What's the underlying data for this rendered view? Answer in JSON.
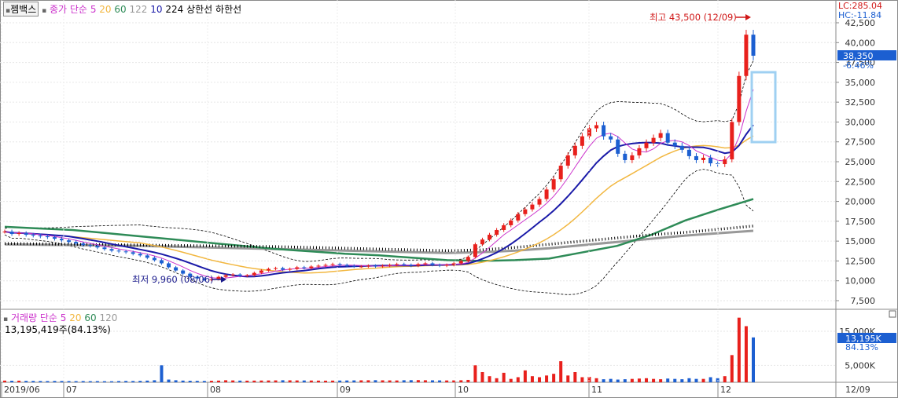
{
  "header": {
    "stock_name": "젬백스",
    "price_ma_label": "종가 단순",
    "ma_periods": [
      "5",
      "20",
      "60",
      "122",
      "10",
      "224"
    ],
    "upper_limit": "상한선",
    "lower_limit": "하한선"
  },
  "volume_header": {
    "label": "거래량 단순",
    "ma_periods": [
      "5",
      "20",
      "60",
      "120"
    ],
    "current_text": "13,195,419주(84.13%)"
  },
  "price_axis": {
    "ticks": [
      "42,500",
      "40,000",
      "37,500",
      "35,000",
      "32,500",
      "30,000",
      "27,500",
      "25,000",
      "22,500",
      "20,000",
      "17,500",
      "15,000",
      "12,500",
      "10,000",
      "7,500"
    ],
    "lc_text": "LC:285.04",
    "hc_text": "HC:-11.84",
    "current_price": "38,350",
    "current_change": "-6.46%"
  },
  "volume_axis": {
    "ticks": [
      "15,000K",
      "5,000K"
    ],
    "current_volume": "13,195K",
    "current_ratio": "84.13%"
  },
  "date_axis": {
    "labels": [
      "2019/06",
      "07",
      "08",
      "09",
      "10",
      "11",
      "12"
    ],
    "corner_label": "12/09"
  },
  "annotations": {
    "high": "최고 43,500 (12/09)",
    "low": "최저 9,960 (08/06)"
  },
  "colors": {
    "up": "#e8201c",
    "down": "#1c5fd1",
    "ma5": "#cc33cc",
    "ma20": "#f2b740",
    "ma60": "#2e8b57",
    "ma122": "#999999",
    "ma10": "#1a1aa8",
    "ma224": "#000000"
  },
  "chart_data": {
    "type": "candlestick",
    "ylim": [
      7500,
      43500
    ],
    "dates": [
      "2019/06",
      "07",
      "08",
      "09",
      "10",
      "11",
      "12"
    ],
    "high": {
      "value": 43500,
      "date": "12/09"
    },
    "low": {
      "value": 9960,
      "date": "08/06"
    },
    "close_series": [
      16200,
      15900,
      16000,
      15800,
      15700,
      15600,
      15500,
      15300,
      15100,
      14900,
      14700,
      14500,
      14400,
      14200,
      14000,
      13800,
      13700,
      13600,
      13400,
      13200,
      12900,
      12600,
      12200,
      11700,
      11300,
      10900,
      10500,
      10300,
      10100,
      10200,
      10500,
      10700,
      10800,
      10600,
      10700,
      11000,
      11300,
      11500,
      11600,
      11400,
      11500,
      11700,
      11600,
      11800,
      11900,
      12000,
      12100,
      12000,
      11900,
      11800,
      11800,
      11900,
      11800,
      11900,
      12000,
      12100,
      12000,
      11900,
      12100,
      12200,
      12000,
      11900,
      12000,
      12200,
      12500,
      13000,
      14600,
      15200,
      15800,
      16400,
      17000,
      17600,
      18400,
      19000,
      19600,
      20300,
      21500,
      22800,
      24500,
      25800,
      27000,
      28200,
      29200,
      29600,
      28200,
      27800,
      26000,
      25200,
      25800,
      26700,
      27400,
      28000,
      28600,
      27400,
      27000,
      26500,
      25700,
      25200,
      25500,
      24800,
      24700,
      25300,
      30000,
      35800,
      41000,
      38350
    ],
    "volume": [
      500,
      450,
      480,
      420,
      400,
      380,
      360,
      400,
      380,
      350,
      340,
      360,
      330,
      350,
      320,
      300,
      360,
      400,
      380,
      420,
      500,
      600,
      5000,
      800,
      600,
      500,
      450,
      420,
      400,
      450,
      500,
      600,
      550,
      500,
      480,
      500,
      520,
      540,
      560,
      600,
      580,
      550,
      540,
      520,
      500,
      480,
      500,
      520,
      540,
      560,
      580,
      600,
      620,
      580,
      560,
      540,
      600,
      620,
      640,
      600,
      580,
      560,
      540,
      560,
      600,
      700,
      5000,
      3000,
      1800,
      1200,
      2800,
      1000,
      1500,
      3500,
      1800,
      1500,
      2000,
      2500,
      6200,
      2000,
      3000,
      1500,
      1600,
      1200,
      900,
      1000,
      800,
      900,
      1000,
      1100,
      1200,
      1000,
      900,
      1100,
      1000,
      900,
      1200,
      1000,
      1000,
      1500,
      1200,
      1800,
      8000,
      19000,
      16500,
      13195
    ],
    "moving_averages": [
      {
        "name": "5"
      },
      {
        "name": "20"
      },
      {
        "name": "60"
      },
      {
        "name": "122"
      },
      {
        "name": "10"
      },
      {
        "name": "224"
      }
    ],
    "ma60_points": [
      16800,
      16600,
      16400,
      16000,
      15600,
      15200,
      14800,
      14400,
      14000,
      13700,
      13400,
      13200,
      12900,
      12600,
      12500,
      12600,
      12800,
      13600,
      14400,
      15800,
      17600,
      19000,
      20300
    ],
    "ma224_points": [
      14700,
      14650,
      14600,
      14550,
      14500,
      14450,
      14400,
      14350,
      14300,
      14200,
      14100,
      14000,
      13900,
      13800,
      13900,
      14200,
      14600,
      15000,
      15400,
      15800,
      16100,
      16500,
      16900
    ],
    "ma122_points": [
      14600,
      14550,
      14500,
      14450,
      14400,
      14300,
      14200,
      14100,
      14000,
      13900,
      13800,
      13700,
      13600,
      13500,
      13600,
      13800,
      14100,
      14500,
      14900,
      15300,
      15700,
      16000,
      16300
    ]
  }
}
